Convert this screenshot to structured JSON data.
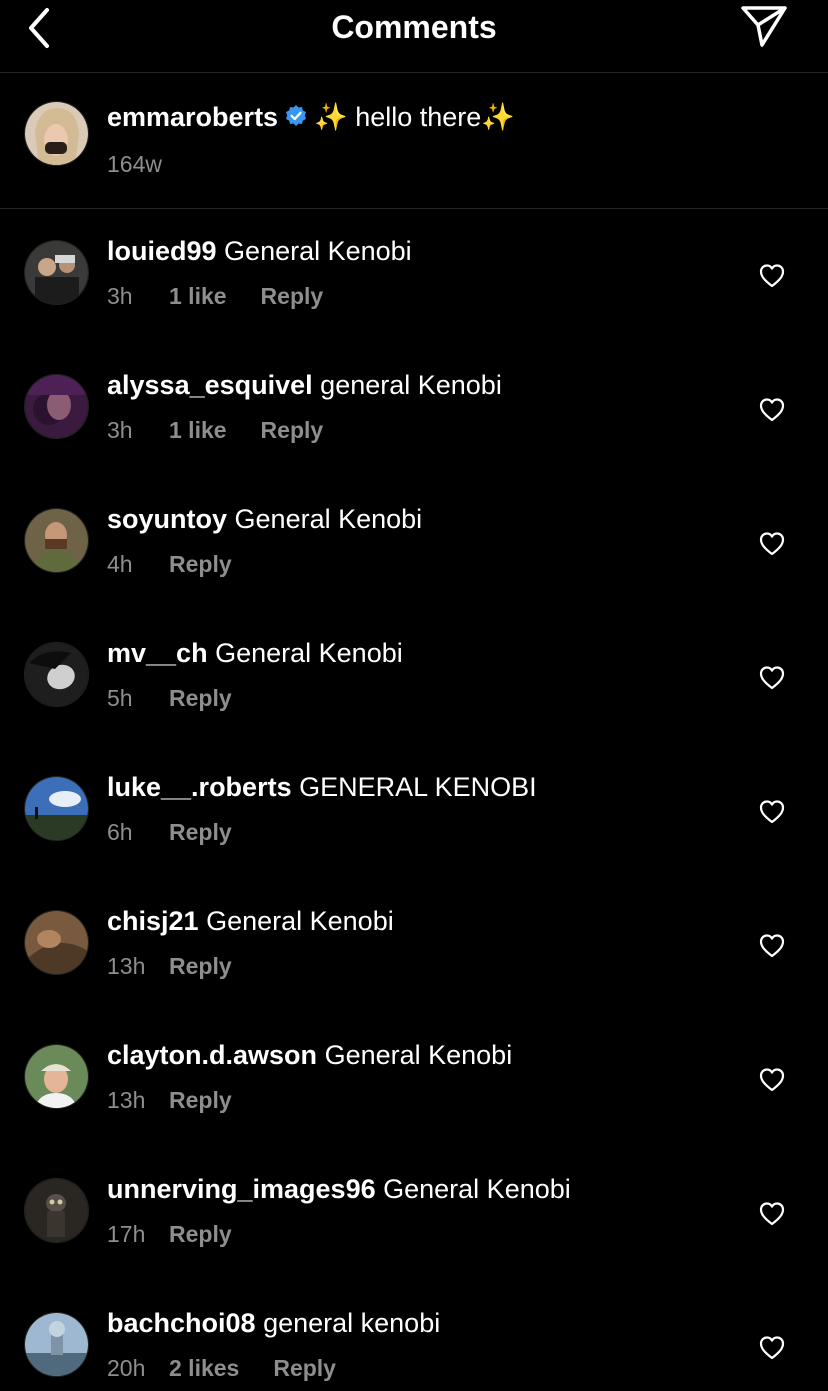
{
  "header": {
    "title": "Comments",
    "back_icon": "chevron-left-icon",
    "share_icon": "paper-plane-icon"
  },
  "caption": {
    "username": "emmaroberts",
    "text": "hello there",
    "sparkle": "✨",
    "time": "164w"
  },
  "comments": [
    {
      "username": "louied99",
      "text": "General Kenobi",
      "time": "3h",
      "likes": "1 like",
      "reply": "Reply"
    },
    {
      "username": "alyssa_esquivel",
      "text": "general Kenobi",
      "time": "3h",
      "likes": "1 like",
      "reply": "Reply"
    },
    {
      "username": "soyuntoy",
      "text": "General Kenobi",
      "time": "4h",
      "likes": "",
      "reply": "Reply"
    },
    {
      "username": "mv__ch",
      "text": "General Kenobi",
      "time": "5h",
      "likes": "",
      "reply": "Reply"
    },
    {
      "username": "luke__.roberts",
      "text": "GENERAL KENOBI",
      "time": "6h",
      "likes": "",
      "reply": "Reply"
    },
    {
      "username": "chisj21",
      "text": "General Kenobi",
      "time": "13h",
      "likes": "",
      "reply": "Reply"
    },
    {
      "username": "clayton.d.awson",
      "text": "General Kenobi",
      "time": "13h",
      "likes": "",
      "reply": "Reply"
    },
    {
      "username": "unnerving_images96",
      "text": "General Kenobi",
      "time": "17h",
      "likes": "",
      "reply": "Reply"
    },
    {
      "username": "bachchoi08",
      "text": "general kenobi",
      "time": "20h",
      "likes": "2 likes",
      "reply": "Reply"
    }
  ],
  "colors": {
    "background": "#000000",
    "secondary_text": "#8e8e8e",
    "divider": "#262626",
    "verified": "#3897f0"
  }
}
